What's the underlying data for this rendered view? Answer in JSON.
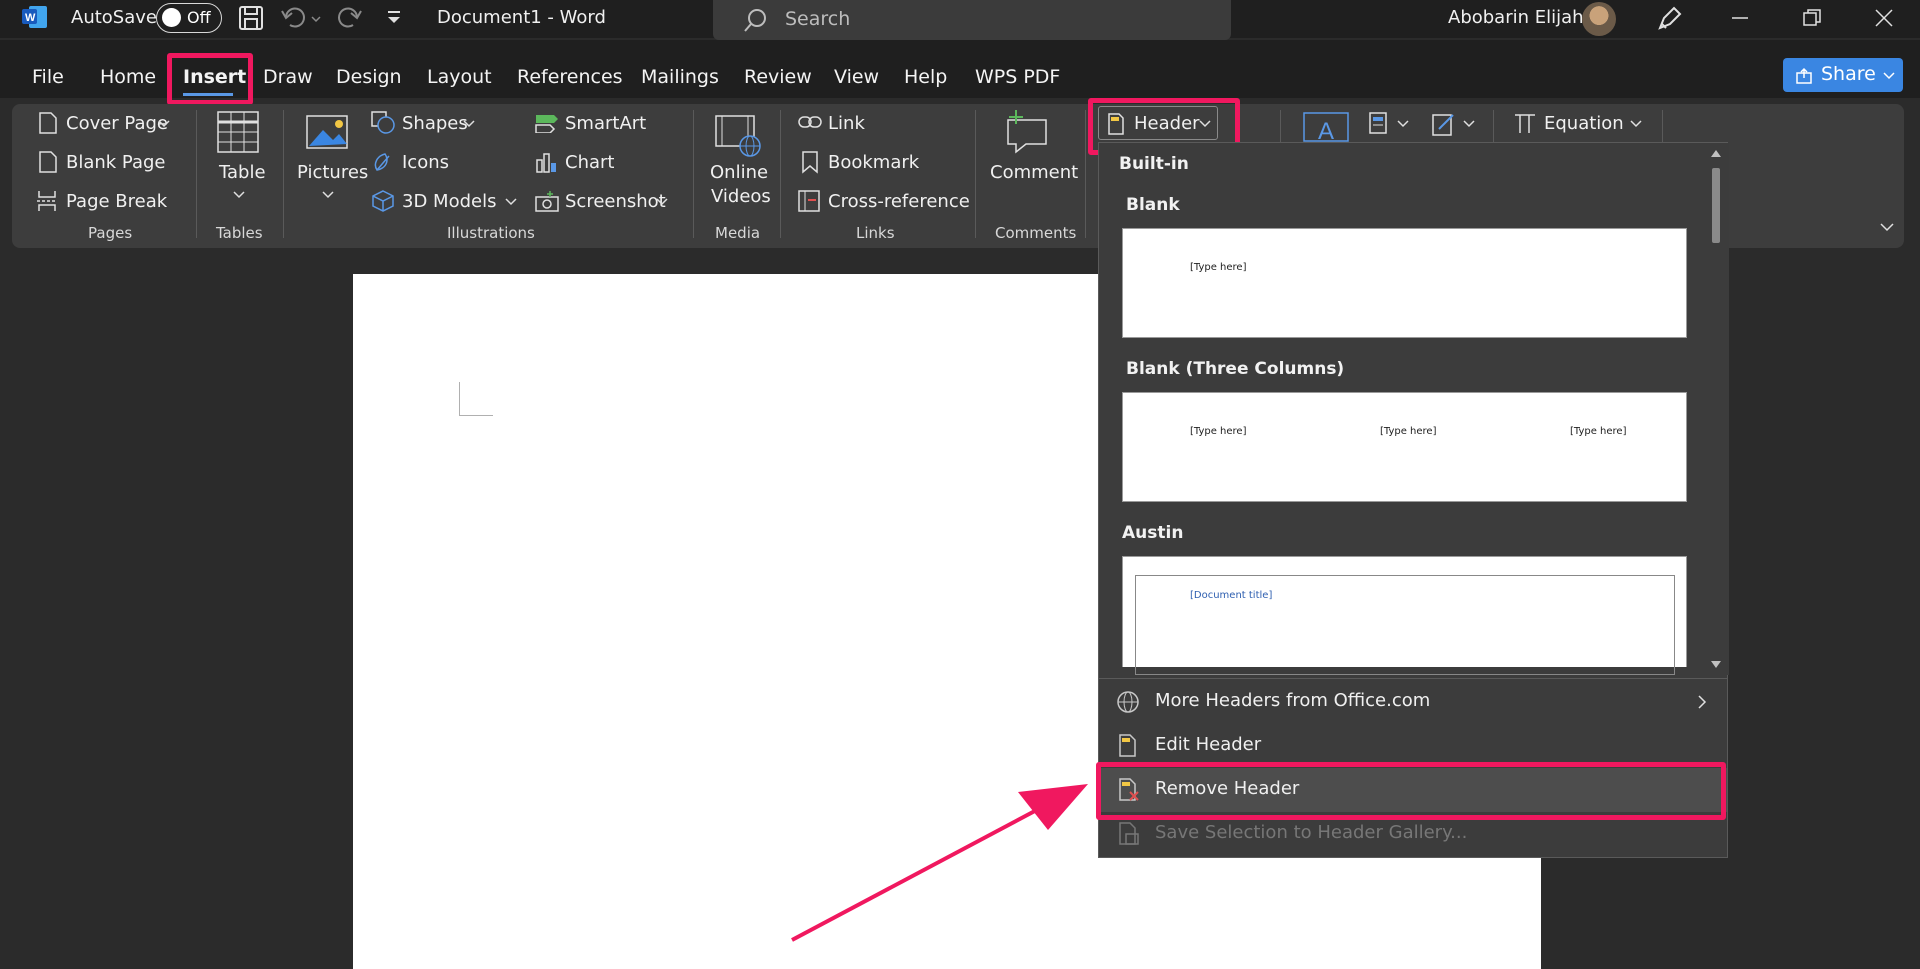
{
  "titlebar": {
    "autosave_label": "AutoSave",
    "autosave_state": "Off",
    "doc_title": "Document1  -  Word",
    "search_placeholder": "Search",
    "user_name": "Abobarin Elijah"
  },
  "menu": {
    "tabs": [
      "File",
      "Home",
      "Insert",
      "Draw",
      "Design",
      "Layout",
      "References",
      "Mailings",
      "Review",
      "View",
      "Help",
      "WPS PDF"
    ],
    "active_tab": "Insert",
    "share_label": "Share"
  },
  "ribbon": {
    "pages": {
      "cover_page": "Cover Page",
      "blank_page": "Blank Page",
      "page_break": "Page Break",
      "group": "Pages"
    },
    "tables": {
      "table": "Table",
      "group": "Tables"
    },
    "illustrations": {
      "pictures": "Pictures",
      "shapes": "Shapes",
      "icons": "Icons",
      "models": "3D Models",
      "smartart": "SmartArt",
      "chart": "Chart",
      "screenshot": "Screenshot",
      "group": "Illustrations"
    },
    "media": {
      "online": "Online",
      "videos": "Videos",
      "group": "Media"
    },
    "links": {
      "link": "Link",
      "bookmark": "Bookmark",
      "cross_reference": "Cross-reference",
      "group": "Links"
    },
    "comments": {
      "comment": "Comment",
      "group": "Comments"
    },
    "header_button": "Header",
    "equation": "Equation"
  },
  "header_dropdown": {
    "section": "Built-in",
    "blank": {
      "title": "Blank",
      "placeholder": "[Type here]"
    },
    "blank_three": {
      "title": "Blank (Three Columns)",
      "placeholders": [
        "[Type here]",
        "[Type here]",
        "[Type here]"
      ]
    },
    "austin": {
      "title": "Austin",
      "placeholder": "[Document title]"
    },
    "more_headers": "More Headers from Office.com",
    "edit_header": "Edit Header",
    "remove_header": "Remove Header",
    "save_selection": "Save Selection to Header Gallery..."
  },
  "colors": {
    "accent_highlight": "#f0185f",
    "word_blue": "#3a86e2"
  }
}
